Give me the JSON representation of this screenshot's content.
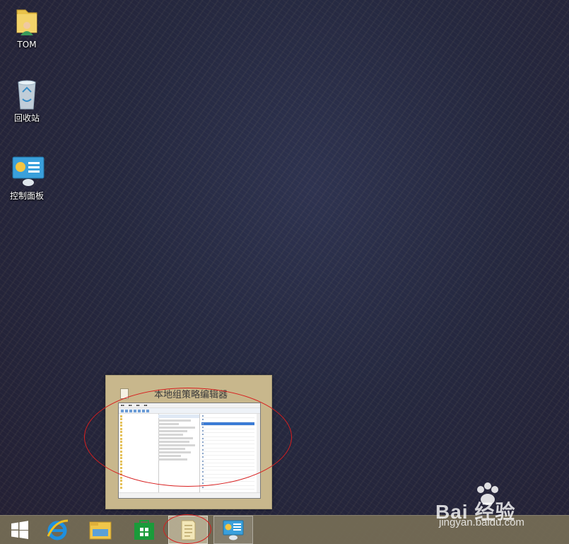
{
  "desktop": {
    "icons": [
      {
        "label": "TOM",
        "icon": "user-folder-icon"
      },
      {
        "label": "回收站",
        "icon": "recycle-bin-icon"
      },
      {
        "label": "控制面板",
        "icon": "control-panel-icon"
      }
    ]
  },
  "preview": {
    "title": "本地组策略编辑器",
    "icon": "notepad-icon"
  },
  "taskbar": {
    "buttons": [
      {
        "name": "windows-start",
        "icon": "windows-logo-icon"
      },
      {
        "name": "internet-explorer",
        "icon": "ie-icon"
      },
      {
        "name": "file-explorer",
        "icon": "folder-icon"
      },
      {
        "name": "store",
        "icon": "store-icon"
      },
      {
        "name": "group-policy-editor",
        "icon": "policy-doc-icon",
        "state": "active"
      },
      {
        "name": "control-panel",
        "icon": "control-panel-icon",
        "state": "open"
      }
    ]
  },
  "watermark": {
    "brand": "Bai 经验",
    "url": "jingyan.baidu.com"
  },
  "colors": {
    "annotation": "#d81e1e",
    "taskbar": "#766e56",
    "preview_bg": "#c8b78c"
  }
}
